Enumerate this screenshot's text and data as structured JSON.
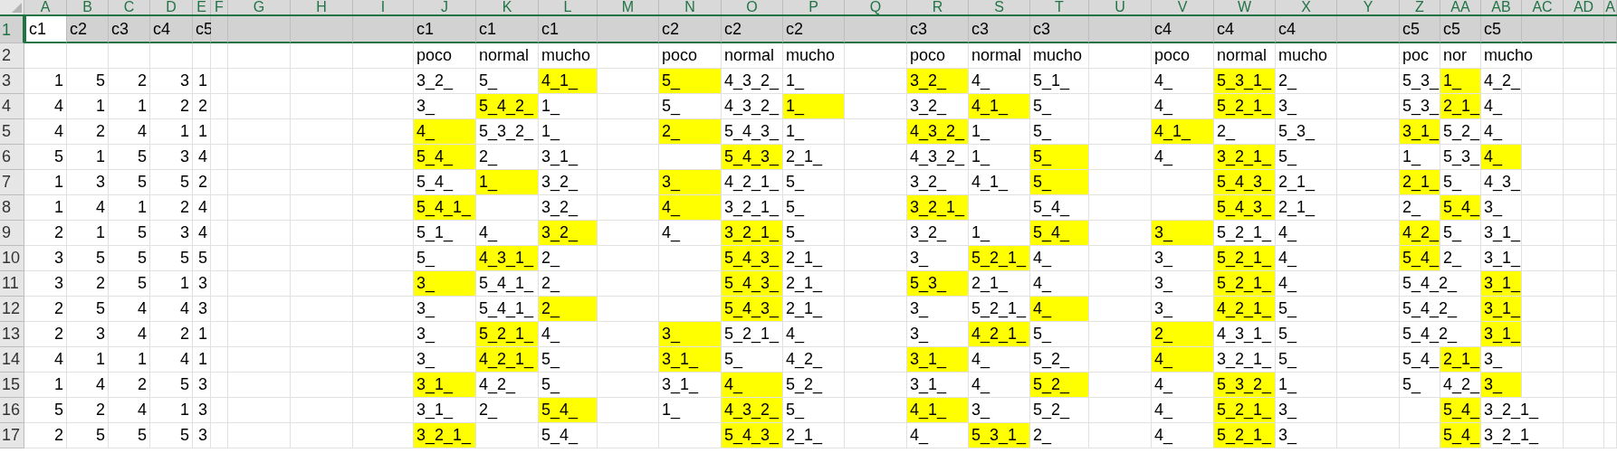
{
  "column_headers": [
    "A",
    "B",
    "C",
    "D",
    "E",
    "F",
    "G",
    "H",
    "I",
    "J",
    "K",
    "L",
    "M",
    "N",
    "O",
    "P",
    "Q",
    "R",
    "S",
    "T",
    "U",
    "V",
    "W",
    "X",
    "Y",
    "Z",
    "AA",
    "AB",
    "AC",
    "AD",
    "A"
  ],
  "rows": [
    {
      "number": "1",
      "selected": true,
      "kind": "header",
      "left": [
        {
          "text": "c1",
          "active": true
        },
        {
          "text": "c2",
          "active": false
        },
        {
          "text": "c3",
          "active": false
        },
        {
          "text": "c4",
          "active": false
        },
        {
          "text": "c5",
          "active": false
        }
      ],
      "groups": [
        [
          {
            "text": "c1",
            "highlighted": false
          },
          {
            "text": "c1",
            "highlighted": false
          },
          {
            "text": "c1",
            "highlighted": false
          }
        ],
        [
          {
            "text": "c2",
            "highlighted": false
          },
          {
            "text": "c2",
            "highlighted": false
          },
          {
            "text": "c2",
            "highlighted": false
          }
        ],
        [
          {
            "text": "c3",
            "highlighted": false
          },
          {
            "text": "c3",
            "highlighted": false
          },
          {
            "text": "c3",
            "highlighted": false
          }
        ],
        [
          {
            "text": "c4",
            "highlighted": false
          },
          {
            "text": "c4",
            "highlighted": false
          },
          {
            "text": "c4",
            "highlighted": false
          }
        ],
        [
          {
            "text": "c5",
            "highlighted": false
          },
          {
            "text": "c5",
            "highlighted": false
          },
          {
            "text": "c5",
            "highlighted": false
          }
        ]
      ]
    },
    {
      "number": "2",
      "selected": false,
      "groups": [
        [
          {
            "text": "poco",
            "highlighted": false
          },
          {
            "text": "normal",
            "highlighted": false
          },
          {
            "text": "mucho",
            "highlighted": false
          }
        ],
        [
          {
            "text": "poco",
            "highlighted": false
          },
          {
            "text": "normal",
            "highlighted": false
          },
          {
            "text": "mucho",
            "highlighted": false
          }
        ],
        [
          {
            "text": "poco",
            "highlighted": false
          },
          {
            "text": "normal",
            "highlighted": false
          },
          {
            "text": "mucho",
            "highlighted": false
          }
        ],
        [
          {
            "text": "poco",
            "highlighted": false
          },
          {
            "text": "normal",
            "highlighted": false
          },
          {
            "text": "mucho",
            "highlighted": false
          }
        ],
        [
          {
            "text": "poc",
            "highlighted": false
          },
          {
            "text": "nor",
            "highlighted": false
          },
          {
            "text": "mucho",
            "highlighted": false
          }
        ]
      ]
    },
    {
      "number": "3",
      "selected": false,
      "kind": "numbers",
      "left": [
        {
          "text": "1",
          "active": false
        },
        {
          "text": "5",
          "active": false
        },
        {
          "text": "2",
          "active": false
        },
        {
          "text": "3",
          "active": false
        },
        {
          "text": "1",
          "active": false
        }
      ],
      "groups": [
        [
          {
            "text": "3_2_",
            "highlighted": false
          },
          {
            "text": "5_",
            "highlighted": false
          },
          {
            "text": "4_1_",
            "highlighted": true
          }
        ],
        [
          {
            "text": "5_",
            "highlighted": true
          },
          {
            "text": "4_3_2_",
            "highlighted": false
          },
          {
            "text": "1_",
            "highlighted": false
          }
        ],
        [
          {
            "text": "3_2_",
            "highlighted": true
          },
          {
            "text": "4_",
            "highlighted": false
          },
          {
            "text": "5_1_",
            "highlighted": false
          }
        ],
        [
          {
            "text": "4_",
            "highlighted": false
          },
          {
            "text": "5_3_1_",
            "highlighted": true
          },
          {
            "text": "2_",
            "highlighted": false
          }
        ],
        [
          {
            "text": "5_3_",
            "highlighted": false
          },
          {
            "text": "1_",
            "highlighted": true
          },
          {
            "text": "4_2_",
            "highlighted": false
          }
        ]
      ]
    },
    {
      "number": "4",
      "selected": false,
      "kind": "numbers",
      "left": [
        {
          "text": "4",
          "active": false
        },
        {
          "text": "1",
          "active": false
        },
        {
          "text": "1",
          "active": false
        },
        {
          "text": "2",
          "active": false
        },
        {
          "text": "2",
          "active": false
        }
      ],
      "groups": [
        [
          {
            "text": "3_",
            "highlighted": false
          },
          {
            "text": "5_4_2_",
            "highlighted": true
          },
          {
            "text": "1_",
            "highlighted": false
          }
        ],
        [
          {
            "text": "5_",
            "highlighted": false
          },
          {
            "text": "4_3_2_",
            "highlighted": false
          },
          {
            "text": "1_",
            "highlighted": true
          }
        ],
        [
          {
            "text": "3_2_",
            "highlighted": false
          },
          {
            "text": "4_1_",
            "highlighted": true
          },
          {
            "text": "5_",
            "highlighted": false
          }
        ],
        [
          {
            "text": "4_",
            "highlighted": false
          },
          {
            "text": "5_2_1_",
            "highlighted": true
          },
          {
            "text": "3_",
            "highlighted": false
          }
        ],
        [
          {
            "text": "5_3_",
            "highlighted": false
          },
          {
            "text": "2_1_",
            "highlighted": true
          },
          {
            "text": "4_",
            "highlighted": false
          }
        ]
      ]
    },
    {
      "number": "5",
      "selected": false,
      "kind": "numbers",
      "left": [
        {
          "text": "4",
          "active": false
        },
        {
          "text": "2",
          "active": false
        },
        {
          "text": "4",
          "active": false
        },
        {
          "text": "1",
          "active": false
        },
        {
          "text": "1",
          "active": false
        }
      ],
      "groups": [
        [
          {
            "text": "4_",
            "highlighted": true
          },
          {
            "text": "5_3_2_",
            "highlighted": false
          },
          {
            "text": "1_",
            "highlighted": false
          }
        ],
        [
          {
            "text": "2_",
            "highlighted": true
          },
          {
            "text": "5_4_3_",
            "highlighted": false
          },
          {
            "text": "1_",
            "highlighted": false
          }
        ],
        [
          {
            "text": "4_3_2_",
            "highlighted": true
          },
          {
            "text": "1_",
            "highlighted": false
          },
          {
            "text": "5_",
            "highlighted": false
          }
        ],
        [
          {
            "text": "4_1_",
            "highlighted": true
          },
          {
            "text": "2_",
            "highlighted": false
          },
          {
            "text": "5_3_",
            "highlighted": false
          }
        ],
        [
          {
            "text": "3_1_",
            "highlighted": true
          },
          {
            "text": "5_2_",
            "highlighted": false
          },
          {
            "text": "4_",
            "highlighted": false
          }
        ]
      ]
    },
    {
      "number": "6",
      "selected": false,
      "kind": "numbers",
      "left": [
        {
          "text": "5",
          "active": false
        },
        {
          "text": "1",
          "active": false
        },
        {
          "text": "5",
          "active": false
        },
        {
          "text": "3",
          "active": false
        },
        {
          "text": "4",
          "active": false
        }
      ],
      "groups": [
        [
          {
            "text": "5_4_",
            "highlighted": true
          },
          {
            "text": "2_",
            "highlighted": false
          },
          {
            "text": "3_1_",
            "highlighted": false
          }
        ],
        [
          {
            "highlighted": false
          },
          {
            "text": "5_4_3_",
            "highlighted": true
          },
          {
            "text": "2_1_",
            "highlighted": false
          }
        ],
        [
          {
            "text": "4_3_2_",
            "highlighted": false
          },
          {
            "text": "1_",
            "highlighted": false
          },
          {
            "text": "5_",
            "highlighted": true
          }
        ],
        [
          {
            "text": "4_",
            "highlighted": false
          },
          {
            "text": "3_2_1_",
            "highlighted": true
          },
          {
            "text": "5_",
            "highlighted": false
          }
        ],
        [
          {
            "text": "1_",
            "highlighted": false
          },
          {
            "text": "5_3_",
            "highlighted": false
          },
          {
            "text": "4_",
            "highlighted": true
          }
        ]
      ]
    },
    {
      "number": "7",
      "selected": false,
      "kind": "numbers",
      "left": [
        {
          "text": "1",
          "active": false
        },
        {
          "text": "3",
          "active": false
        },
        {
          "text": "5",
          "active": false
        },
        {
          "text": "5",
          "active": false
        },
        {
          "text": "2",
          "active": false
        }
      ],
      "groups": [
        [
          {
            "text": "5_4_",
            "highlighted": false
          },
          {
            "text": "1_",
            "highlighted": true
          },
          {
            "text": "3_2_",
            "highlighted": false
          }
        ],
        [
          {
            "text": "3_",
            "highlighted": true
          },
          {
            "text": "4_2_1_",
            "highlighted": false
          },
          {
            "text": "5_",
            "highlighted": false
          }
        ],
        [
          {
            "text": "3_2_",
            "highlighted": false
          },
          {
            "text": "4_1_",
            "highlighted": false
          },
          {
            "text": "5_",
            "highlighted": true
          }
        ],
        [
          {
            "highlighted": false
          },
          {
            "text": "5_4_3_",
            "highlighted": true
          },
          {
            "text": "2_1_",
            "highlighted": false
          }
        ],
        [
          {
            "text": "2_1_",
            "highlighted": true
          },
          {
            "text": "5_",
            "highlighted": false
          },
          {
            "text": "4_3_",
            "highlighted": false
          }
        ]
      ]
    },
    {
      "number": "8",
      "selected": false,
      "kind": "numbers",
      "left": [
        {
          "text": "1",
          "active": false
        },
        {
          "text": "4",
          "active": false
        },
        {
          "text": "1",
          "active": false
        },
        {
          "text": "2",
          "active": false
        },
        {
          "text": "4",
          "active": false
        }
      ],
      "groups": [
        [
          {
            "text": "5_4_1_",
            "highlighted": true
          },
          {
            "highlighted": false
          },
          {
            "text": "3_2_",
            "highlighted": false
          }
        ],
        [
          {
            "text": "4_",
            "highlighted": true
          },
          {
            "text": "3_2_1_",
            "highlighted": false
          },
          {
            "text": "5_",
            "highlighted": false
          }
        ],
        [
          {
            "text": "3_2_1_",
            "highlighted": true
          },
          {
            "highlighted": false
          },
          {
            "text": "5_4_",
            "highlighted": false
          }
        ],
        [
          {
            "highlighted": false
          },
          {
            "text": "5_4_3_",
            "highlighted": true
          },
          {
            "text": "2_1_",
            "highlighted": false
          }
        ],
        [
          {
            "text": "2_",
            "highlighted": false
          },
          {
            "text": "5_4_",
            "highlighted": true
          },
          {
            "text": "3_",
            "highlighted": false
          }
        ]
      ]
    },
    {
      "number": "9",
      "selected": false,
      "kind": "numbers",
      "left": [
        {
          "text": "2",
          "active": false
        },
        {
          "text": "1",
          "active": false
        },
        {
          "text": "5",
          "active": false
        },
        {
          "text": "3",
          "active": false
        },
        {
          "text": "4",
          "active": false
        }
      ],
      "groups": [
        [
          {
            "text": "5_1_",
            "highlighted": false
          },
          {
            "text": "4_",
            "highlighted": false
          },
          {
            "text": "3_2_",
            "highlighted": true
          }
        ],
        [
          {
            "text": "4_",
            "highlighted": false
          },
          {
            "text": "3_2_1_",
            "highlighted": true
          },
          {
            "text": "5_",
            "highlighted": false
          }
        ],
        [
          {
            "text": "3_2_",
            "highlighted": false
          },
          {
            "text": "1_",
            "highlighted": false
          },
          {
            "text": "5_4_",
            "highlighted": true
          }
        ],
        [
          {
            "text": "3_",
            "highlighted": true
          },
          {
            "text": "5_2_1_",
            "highlighted": false
          },
          {
            "text": "4_",
            "highlighted": false
          }
        ],
        [
          {
            "text": "4_2_",
            "highlighted": true
          },
          {
            "text": "5_",
            "highlighted": false
          },
          {
            "text": "3_1_",
            "highlighted": false
          }
        ]
      ]
    },
    {
      "number": "10",
      "selected": false,
      "kind": "numbers",
      "left": [
        {
          "text": "3",
          "active": false
        },
        {
          "text": "5",
          "active": false
        },
        {
          "text": "5",
          "active": false
        },
        {
          "text": "5",
          "active": false
        },
        {
          "text": "5",
          "active": false
        }
      ],
      "groups": [
        [
          {
            "text": "5_",
            "highlighted": false
          },
          {
            "text": "4_3_1_",
            "highlighted": true
          },
          {
            "text": "2_",
            "highlighted": false
          }
        ],
        [
          {
            "highlighted": false
          },
          {
            "text": "5_4_3_",
            "highlighted": true
          },
          {
            "text": "2_1_",
            "highlighted": false
          }
        ],
        [
          {
            "text": "3_",
            "highlighted": false
          },
          {
            "text": "5_2_1_",
            "highlighted": true
          },
          {
            "text": "4_",
            "highlighted": false
          }
        ],
        [
          {
            "text": "3_",
            "highlighted": false
          },
          {
            "text": "5_2_1_",
            "highlighted": true
          },
          {
            "text": "4_",
            "highlighted": false
          }
        ],
        [
          {
            "text": "5_4_",
            "highlighted": true
          },
          {
            "text": "2_",
            "highlighted": false
          },
          {
            "text": "3_1_",
            "highlighted": false
          }
        ]
      ]
    },
    {
      "number": "11",
      "selected": false,
      "kind": "numbers",
      "left": [
        {
          "text": "3",
          "active": false
        },
        {
          "text": "2",
          "active": false
        },
        {
          "text": "5",
          "active": false
        },
        {
          "text": "1",
          "active": false
        },
        {
          "text": "3",
          "active": false
        }
      ],
      "groups": [
        [
          {
            "text": "3_",
            "highlighted": true
          },
          {
            "text": "5_4_1_",
            "highlighted": false
          },
          {
            "text": "2_",
            "highlighted": false
          }
        ],
        [
          {
            "highlighted": false
          },
          {
            "text": "5_4_3_",
            "highlighted": true
          },
          {
            "text": "2_1_",
            "highlighted": false
          }
        ],
        [
          {
            "text": "5_3_",
            "highlighted": true
          },
          {
            "text": "2_1_",
            "highlighted": false
          },
          {
            "text": "4_",
            "highlighted": false
          }
        ],
        [
          {
            "text": "3_",
            "highlighted": false
          },
          {
            "text": "5_2_1_",
            "highlighted": true
          },
          {
            "text": "4_",
            "highlighted": false
          }
        ],
        [
          {
            "text": "5_4_2_",
            "highlighted": false
          },
          {
            "highlighted": false
          },
          {
            "text": "3_1_",
            "highlighted": true
          }
        ]
      ]
    },
    {
      "number": "12",
      "selected": false,
      "kind": "numbers",
      "left": [
        {
          "text": "2",
          "active": false
        },
        {
          "text": "5",
          "active": false
        },
        {
          "text": "4",
          "active": false
        },
        {
          "text": "4",
          "active": false
        },
        {
          "text": "3",
          "active": false
        }
      ],
      "groups": [
        [
          {
            "text": "3_",
            "highlighted": false
          },
          {
            "text": "5_4_1_",
            "highlighted": false
          },
          {
            "text": "2_",
            "highlighted": true
          }
        ],
        [
          {
            "highlighted": false
          },
          {
            "text": "5_4_3_",
            "highlighted": true
          },
          {
            "text": "2_1_",
            "highlighted": false
          }
        ],
        [
          {
            "text": "3_",
            "highlighted": false
          },
          {
            "text": "5_2_1_",
            "highlighted": false
          },
          {
            "text": "4_",
            "highlighted": true
          }
        ],
        [
          {
            "text": "3_",
            "highlighted": false
          },
          {
            "text": "4_2_1_",
            "highlighted": true
          },
          {
            "text": "5_",
            "highlighted": false
          }
        ],
        [
          {
            "text": "5_4_2_",
            "highlighted": false
          },
          {
            "highlighted": false
          },
          {
            "text": "3_1_",
            "highlighted": true
          }
        ]
      ]
    },
    {
      "number": "13",
      "selected": false,
      "kind": "numbers",
      "left": [
        {
          "text": "2",
          "active": false
        },
        {
          "text": "3",
          "active": false
        },
        {
          "text": "4",
          "active": false
        },
        {
          "text": "2",
          "active": false
        },
        {
          "text": "1",
          "active": false
        }
      ],
      "groups": [
        [
          {
            "text": "3_",
            "highlighted": false
          },
          {
            "text": "5_2_1_",
            "highlighted": true
          },
          {
            "text": "4_",
            "highlighted": false
          }
        ],
        [
          {
            "text": "3_",
            "highlighted": true
          },
          {
            "text": "5_2_1_",
            "highlighted": false
          },
          {
            "text": "4_",
            "highlighted": false
          }
        ],
        [
          {
            "text": "3_",
            "highlighted": false
          },
          {
            "text": "4_2_1_",
            "highlighted": true
          },
          {
            "text": "5_",
            "highlighted": false
          }
        ],
        [
          {
            "text": "2_",
            "highlighted": true
          },
          {
            "text": "4_3_1_",
            "highlighted": false
          },
          {
            "text": "5_",
            "highlighted": false
          }
        ],
        [
          {
            "text": "5_4_2_",
            "highlighted": false
          },
          {
            "highlighted": false
          },
          {
            "text": "3_1_",
            "highlighted": true
          }
        ]
      ]
    },
    {
      "number": "14",
      "selected": false,
      "kind": "numbers",
      "left": [
        {
          "text": "4",
          "active": false
        },
        {
          "text": "1",
          "active": false
        },
        {
          "text": "1",
          "active": false
        },
        {
          "text": "4",
          "active": false
        },
        {
          "text": "1",
          "active": false
        }
      ],
      "groups": [
        [
          {
            "text": "3_",
            "highlighted": false
          },
          {
            "text": "4_2_1_",
            "highlighted": true
          },
          {
            "text": "5_",
            "highlighted": false
          }
        ],
        [
          {
            "text": "3_1_",
            "highlighted": true
          },
          {
            "text": "5_",
            "highlighted": false
          },
          {
            "text": "4_2_",
            "highlighted": false
          }
        ],
        [
          {
            "text": "3_1_",
            "highlighted": true
          },
          {
            "text": "4_",
            "highlighted": false
          },
          {
            "text": "5_2_",
            "highlighted": false
          }
        ],
        [
          {
            "text": "4_",
            "highlighted": true
          },
          {
            "text": "3_2_1_",
            "highlighted": false
          },
          {
            "text": "5_",
            "highlighted": false
          }
        ],
        [
          {
            "text": "5_4_",
            "highlighted": false
          },
          {
            "text": "2_1_",
            "highlighted": true
          },
          {
            "text": "3_",
            "highlighted": false
          }
        ]
      ]
    },
    {
      "number": "15",
      "selected": false,
      "kind": "numbers",
      "left": [
        {
          "text": "1",
          "active": false
        },
        {
          "text": "4",
          "active": false
        },
        {
          "text": "2",
          "active": false
        },
        {
          "text": "5",
          "active": false
        },
        {
          "text": "3",
          "active": false
        }
      ],
      "groups": [
        [
          {
            "text": "3_1_",
            "highlighted": true
          },
          {
            "text": "4_2_",
            "highlighted": false
          },
          {
            "text": "5_",
            "highlighted": false
          }
        ],
        [
          {
            "text": "3_1_",
            "highlighted": false
          },
          {
            "text": "4_",
            "highlighted": true
          },
          {
            "text": "5_2_",
            "highlighted": false
          }
        ],
        [
          {
            "text": "3_1_",
            "highlighted": false
          },
          {
            "text": "4_",
            "highlighted": false
          },
          {
            "text": "5_2_",
            "highlighted": true
          }
        ],
        [
          {
            "text": "4_",
            "highlighted": false
          },
          {
            "text": "5_3_2_",
            "highlighted": true
          },
          {
            "text": "1_",
            "highlighted": false
          }
        ],
        [
          {
            "text": "5_",
            "highlighted": false
          },
          {
            "text": "4_2_",
            "highlighted": false
          },
          {
            "text": "3_",
            "highlighted": true
          }
        ]
      ]
    },
    {
      "number": "16",
      "selected": false,
      "kind": "numbers",
      "left": [
        {
          "text": "5",
          "active": false
        },
        {
          "text": "2",
          "active": false
        },
        {
          "text": "4",
          "active": false
        },
        {
          "text": "1",
          "active": false
        },
        {
          "text": "3",
          "active": false
        }
      ],
      "groups": [
        [
          {
            "text": "3_1_",
            "highlighted": false
          },
          {
            "text": "2_",
            "highlighted": false
          },
          {
            "text": "5_4_",
            "highlighted": true
          }
        ],
        [
          {
            "text": "1_",
            "highlighted": false
          },
          {
            "text": "4_3_2_",
            "highlighted": true
          },
          {
            "text": "5_",
            "highlighted": false
          }
        ],
        [
          {
            "text": "4_1_",
            "highlighted": true
          },
          {
            "text": "3_",
            "highlighted": false
          },
          {
            "text": "5_2_",
            "highlighted": false
          }
        ],
        [
          {
            "text": "4_",
            "highlighted": false
          },
          {
            "text": "5_2_1_",
            "highlighted": true
          },
          {
            "text": "3_",
            "highlighted": false
          }
        ],
        [
          {
            "highlighted": false
          },
          {
            "text": "5_4_",
            "highlighted": true
          },
          {
            "text": "3_2_1_",
            "highlighted": false
          }
        ]
      ]
    },
    {
      "number": "17",
      "selected": false,
      "kind": "numbers",
      "left": [
        {
          "text": "2",
          "active": false
        },
        {
          "text": "5",
          "active": false
        },
        {
          "text": "5",
          "active": false
        },
        {
          "text": "5",
          "active": false
        },
        {
          "text": "3",
          "active": false
        }
      ],
      "groups": [
        [
          {
            "text": "3_2_1_",
            "highlighted": true
          },
          {
            "highlighted": false
          },
          {
            "text": "5_4_",
            "highlighted": false
          }
        ],
        [
          {
            "highlighted": false
          },
          {
            "text": "5_4_3_",
            "highlighted": true
          },
          {
            "text": "2_1_",
            "highlighted": false
          }
        ],
        [
          {
            "text": "4_",
            "highlighted": false
          },
          {
            "text": "5_3_1_",
            "highlighted": true
          },
          {
            "text": "2_",
            "highlighted": false
          }
        ],
        [
          {
            "text": "4_",
            "highlighted": false
          },
          {
            "text": "5_2_1_",
            "highlighted": true
          },
          {
            "text": "3_",
            "highlighted": false
          }
        ],
        [
          {
            "highlighted": false
          },
          {
            "text": "5_4_",
            "highlighted": true
          },
          {
            "text": "3_2_1_",
            "highlighted": false
          }
        ]
      ]
    }
  ]
}
